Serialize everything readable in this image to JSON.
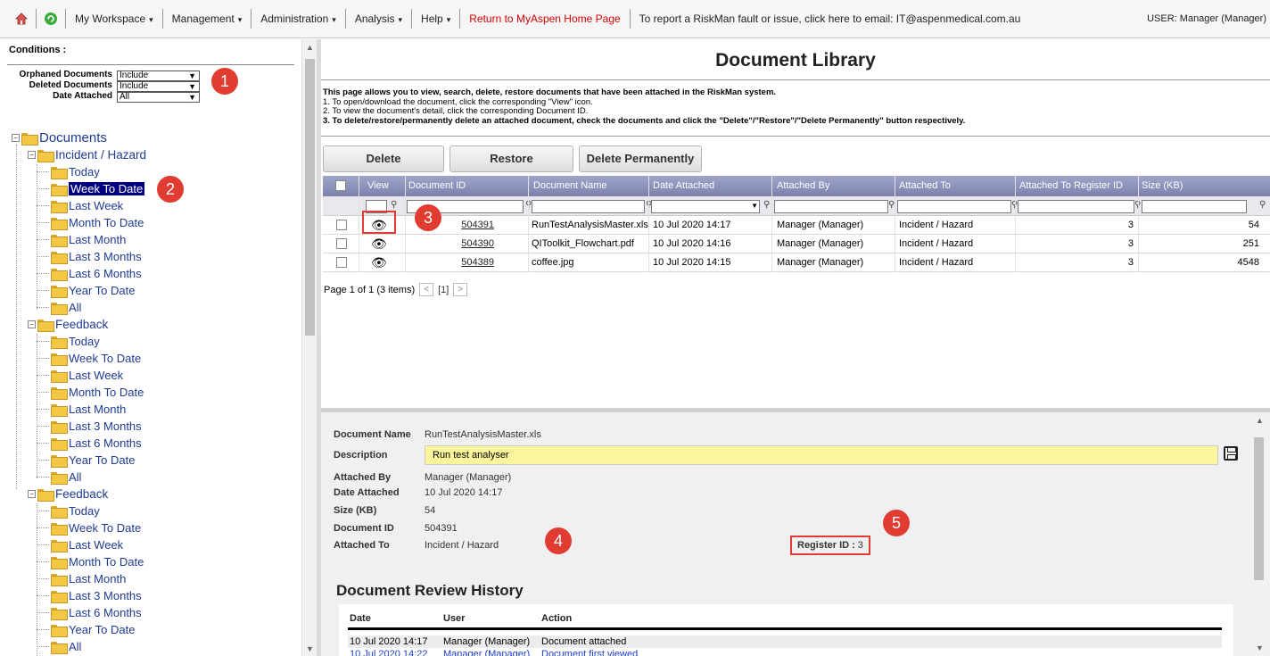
{
  "menubar": {
    "icons": [
      "home-icon",
      "refresh-icon"
    ],
    "items": [
      {
        "label": "My Workspace",
        "caret": "▾"
      },
      {
        "label": "Management",
        "caret": "▾"
      },
      {
        "label": "Administration",
        "caret": "▾"
      },
      {
        "label": "Analysis",
        "caret": "▾"
      },
      {
        "label": "Help",
        "caret": "▾"
      }
    ],
    "return_link": "Return to MyAspen Home Page",
    "report_text": "To report a RiskMan fault or issue, click here to email: IT@aspenmedical.com.au",
    "user": "USER: Manager (Manager)",
    "accent": "#d40000"
  },
  "conditions": {
    "title": "Conditions :",
    "rows": [
      {
        "label": "Orphaned Documents",
        "value": "Include"
      },
      {
        "label": "Deleted Documents",
        "value": "Include"
      },
      {
        "label": "Date Attached",
        "value": "All"
      }
    ]
  },
  "tree": {
    "root": "Documents",
    "groups": [
      {
        "label": "Incident / Hazard",
        "items": [
          "Today",
          "Week To Date",
          "Last Week",
          "Month To Date",
          "Last Month",
          "Last 3 Months",
          "Last 6 Months",
          "Year To Date",
          "All"
        ],
        "selected": "Week To Date"
      },
      {
        "label": "Feedback",
        "items": [
          "Today",
          "Week To Date",
          "Last Week",
          "Month To Date",
          "Last Month",
          "Last 3 Months",
          "Last 6 Months",
          "Year To Date",
          "All"
        ]
      },
      {
        "label": "Feedback",
        "items": [
          "Today",
          "Week To Date",
          "Last Week",
          "Month To Date",
          "Last Month",
          "Last 3 Months",
          "Last 6 Months",
          "Year To Date",
          "All"
        ]
      }
    ]
  },
  "main": {
    "title": "Document Library",
    "intro": "This page allows you to view, search, delete, restore documents that have been attached in the RiskMan system.",
    "steps": [
      "1. To open/download the document, click the corresponding \"View\" icon.",
      "2. To view the document's detail, click the corresponding Document ID.",
      "3. To delete/restore/permanently delete an attached document, check the documents and click the \"Delete\"/\"Restore\"/\"Delete Permanently\" button respectively."
    ],
    "buttons": {
      "delete": "Delete",
      "restore": "Restore",
      "delete_permanently": "Delete Permanently"
    }
  },
  "grid": {
    "columns": [
      "View",
      "Document ID",
      "Document Name",
      "Date Attached",
      "Attached By",
      "Attached To",
      "Attached To Register ID",
      "Size (KB)"
    ],
    "rows": [
      {
        "id": "504391",
        "name": "RunTestAnalysisMaster.xls",
        "date": "10 Jul 2020 14:17",
        "by": "Manager (Manager)",
        "to": "Incident / Hazard",
        "reg": "3",
        "size": "54"
      },
      {
        "id": "504390",
        "name": "QIToolkit_Flowchart.pdf",
        "date": "10 Jul 2020 14:16",
        "by": "Manager (Manager)",
        "to": "Incident / Hazard",
        "reg": "3",
        "size": "251"
      },
      {
        "id": "504389",
        "name": "coffee.jpg",
        "date": "10 Jul 2020 14:15",
        "by": "Manager (Manager)",
        "to": "Incident / Hazard",
        "reg": "3",
        "size": "4548"
      }
    ],
    "pager": {
      "summary": "Page 1 of 1 (3 items)",
      "prev": "<",
      "page": "[1]",
      "next": ">"
    }
  },
  "detail": {
    "labels": {
      "name": "Document Name",
      "description": "Description",
      "by": "Attached By",
      "date": "Date Attached",
      "size": "Size (KB)",
      "id": "Document ID",
      "to": "Attached To",
      "reg": "Register ID :"
    },
    "values": {
      "name": "RunTestAnalysisMaster.xls",
      "description": "Run test analyser",
      "by": "Manager (Manager)",
      "date": "10 Jul 2020 14:17",
      "size": "54",
      "id": "504391",
      "to": "Incident / Hazard",
      "reg": "3"
    },
    "history": {
      "title": "Document Review History",
      "headers": [
        "Date",
        "User",
        "Action"
      ],
      "rows": [
        {
          "date": "10 Jul 2020 14:17",
          "user": "Manager (Manager)",
          "action": "Document attached"
        },
        {
          "date": "10 Jul 2020 14:22",
          "user": "Manager (Manager)",
          "action": "Document first viewed"
        }
      ]
    }
  },
  "annotations": [
    "1",
    "2",
    "3",
    "4",
    "5"
  ],
  "colors": {
    "annotation": "#e03c31",
    "header_grid": "#8a90b8",
    "tree_link": "#1f3a93",
    "description_bg": "#fbf59c"
  }
}
